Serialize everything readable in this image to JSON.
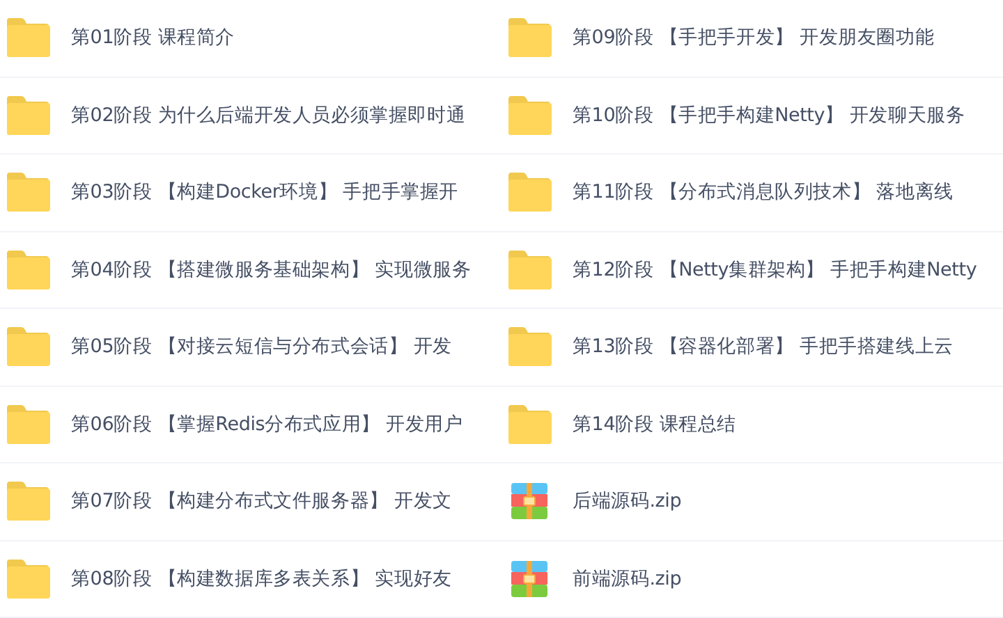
{
  "columns": [
    {
      "items": [
        {
          "kind": "folder",
          "name": "第01阶段 课程简介"
        },
        {
          "kind": "folder",
          "name": "第02阶段 为什么后端开发人员必须掌握即时通"
        },
        {
          "kind": "folder",
          "name": "第03阶段 【构建Docker环境】 手把手掌握开"
        },
        {
          "kind": "folder",
          "name": "第04阶段 【搭建微服务基础架构】 实现微服务"
        },
        {
          "kind": "folder",
          "name": "第05阶段 【对接云短信与分布式会话】 开发"
        },
        {
          "kind": "folder",
          "name": "第06阶段 【掌握Redis分布式应用】 开发用户"
        },
        {
          "kind": "folder",
          "name": "第07阶段 【构建分布式文件服务器】 开发文"
        },
        {
          "kind": "folder",
          "name": "第08阶段 【构建数据库多表关系】 实现好友"
        }
      ]
    },
    {
      "items": [
        {
          "kind": "folder",
          "name": "第09阶段 【手把手开发】 开发朋友圈功能"
        },
        {
          "kind": "folder",
          "name": "第10阶段 【手把手构建Netty】 开发聊天服务"
        },
        {
          "kind": "folder",
          "name": "第11阶段 【分布式消息队列技术】 落地离线"
        },
        {
          "kind": "folder",
          "name": "第12阶段 【Netty集群架构】 手把手构建Netty"
        },
        {
          "kind": "folder",
          "name": "第13阶段 【容器化部署】 手把手搭建线上云"
        },
        {
          "kind": "folder",
          "name": "第14阶段 课程总结"
        },
        {
          "kind": "zip",
          "name": "后端源码.zip"
        },
        {
          "kind": "zip",
          "name": "前端源码.zip"
        }
      ]
    }
  ]
}
